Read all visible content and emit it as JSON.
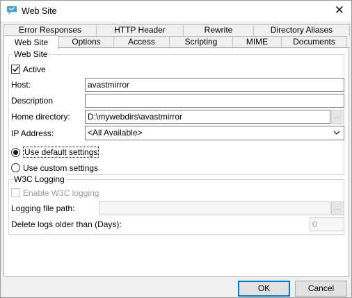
{
  "window": {
    "title": "Web Site",
    "close_glyph": "✕",
    "icon": "app-icon"
  },
  "tabs": {
    "back_row": [
      {
        "label": "Error Responses"
      },
      {
        "label": "HTTP Header"
      },
      {
        "label": "Rewrite"
      },
      {
        "label": "Directory Aliases"
      }
    ],
    "front_row": [
      {
        "label": "Web Site",
        "active": true
      },
      {
        "label": "Options"
      },
      {
        "label": "Access"
      },
      {
        "label": "Scripting"
      },
      {
        "label": "MIME"
      },
      {
        "label": "Documents"
      }
    ]
  },
  "web_site_group": {
    "title": "Web Site",
    "active_label": "Active",
    "active_checked": true,
    "host_label": "Host:",
    "host_value": "avastmirror",
    "description_label": "Description",
    "description_value": "",
    "home_dir_label": "Home directory:",
    "home_dir_value": "D:\\mywebdirs\\avastmirror",
    "browse_label": "...",
    "ip_label": "IP Address:",
    "ip_value": "<All Available>",
    "default_settings_label": "Use default settings",
    "custom_settings_label": "Use custom settings",
    "selected": "default"
  },
  "w3c_group": {
    "title": "W3C Logging",
    "enable_label": "Enable W3C logging",
    "path_label": "Logging file path:",
    "path_value": "",
    "browse_label": "...",
    "delete_label": "Delete logs older than (Days):",
    "delete_value": "0"
  },
  "buttons": {
    "ok": "OK",
    "cancel": "Cancel"
  },
  "colors": {
    "accent": "#0078d7",
    "icon_blue": "#3aa0e6",
    "border": "#adadad"
  }
}
